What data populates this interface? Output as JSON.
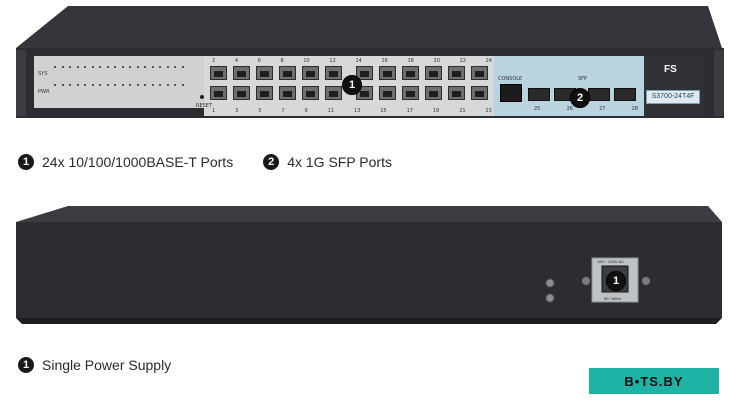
{
  "front": {
    "callouts": [
      "1",
      "2"
    ],
    "labels": {
      "sys": "SYS",
      "pwr": "PWR",
      "reset": "RESET",
      "console": "CONSOLE",
      "sfp": "SFP",
      "brand": "FS",
      "model": "S3700-24T4F"
    },
    "port_numbers_top": [
      "2",
      "4",
      "6",
      "8",
      "10",
      "12",
      "14",
      "16",
      "18",
      "20",
      "22",
      "24"
    ],
    "port_numbers_bottom": [
      "1",
      "3",
      "5",
      "7",
      "9",
      "11",
      "13",
      "15",
      "17",
      "19",
      "21",
      "23"
    ],
    "sfp_numbers": [
      "25",
      "26",
      "27",
      "28"
    ]
  },
  "legend_front": [
    {
      "num": "1",
      "text": "24x 10/100/1000BASE-T Ports"
    },
    {
      "num": "2",
      "text": "4x 1G SFP Ports"
    }
  ],
  "back": {
    "callout": "1",
    "power_top_label": "100 ~ 240V AC",
    "power_bottom_label": "50 / 60Hz"
  },
  "legend_back": [
    {
      "num": "1",
      "text": "Single Power Supply"
    }
  ],
  "watermark": "B•TS.BY",
  "colors": {
    "chassis": "#2b2d30",
    "faceplate": "#c9cbcd",
    "sfp_panel": "#b9d3df",
    "watermark_bg": "#1fb3a6"
  }
}
